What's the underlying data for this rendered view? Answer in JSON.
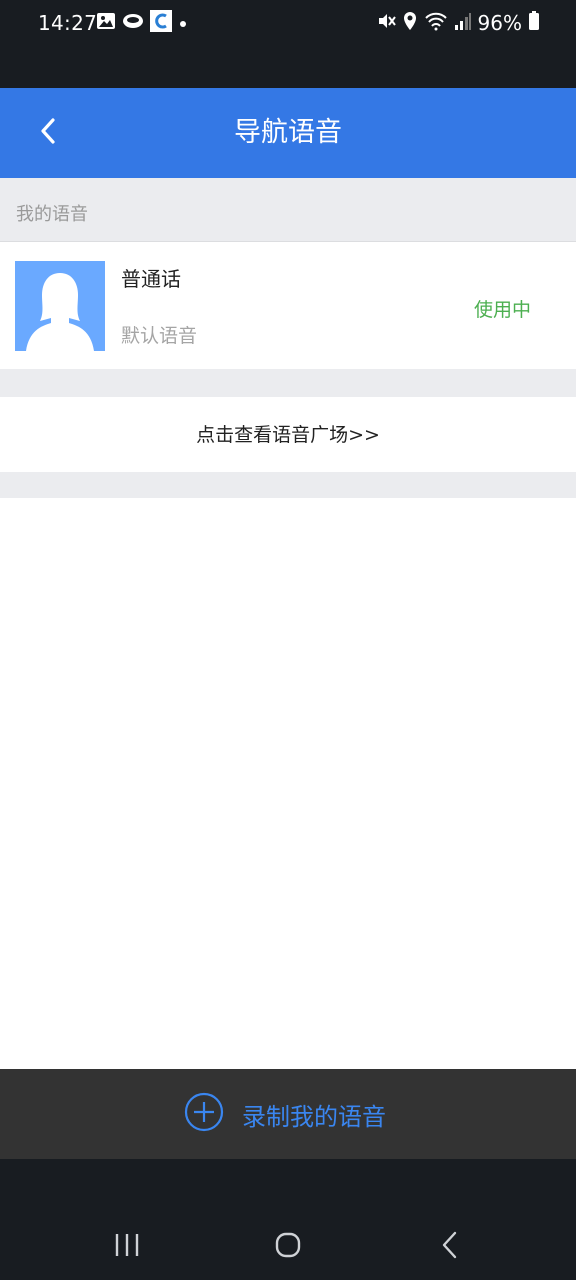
{
  "status_bar": {
    "time": "14:27",
    "battery_percent": "96%",
    "left_icons": [
      "image-icon",
      "cloud-app-icon",
      "browser-app-icon",
      "dot-icon"
    ],
    "right_icons": [
      "mute-icon",
      "location-icon",
      "wifi-icon",
      "signal-icon",
      "battery-icon"
    ]
  },
  "header": {
    "title": "导航语音",
    "back_icon": "chevron-left-icon"
  },
  "section": {
    "label": "我的语音"
  },
  "voice_item": {
    "name": "普通话",
    "subtitle": "默认语音",
    "status": "使用中",
    "avatar_icon": "female-avatar-icon"
  },
  "plaza_link": {
    "label": "点击查看语音广场>>"
  },
  "record": {
    "label": "录制我的语音",
    "icon": "plus-circle-icon"
  },
  "nav": {
    "recents_icon": "recents-icon",
    "home_icon": "home-icon",
    "back_icon": "back-icon"
  },
  "colors": {
    "header_blue": "#3478e5",
    "status_green": "#4caf50",
    "record_blue": "#3a86f0",
    "dark_bar": "#333333"
  }
}
